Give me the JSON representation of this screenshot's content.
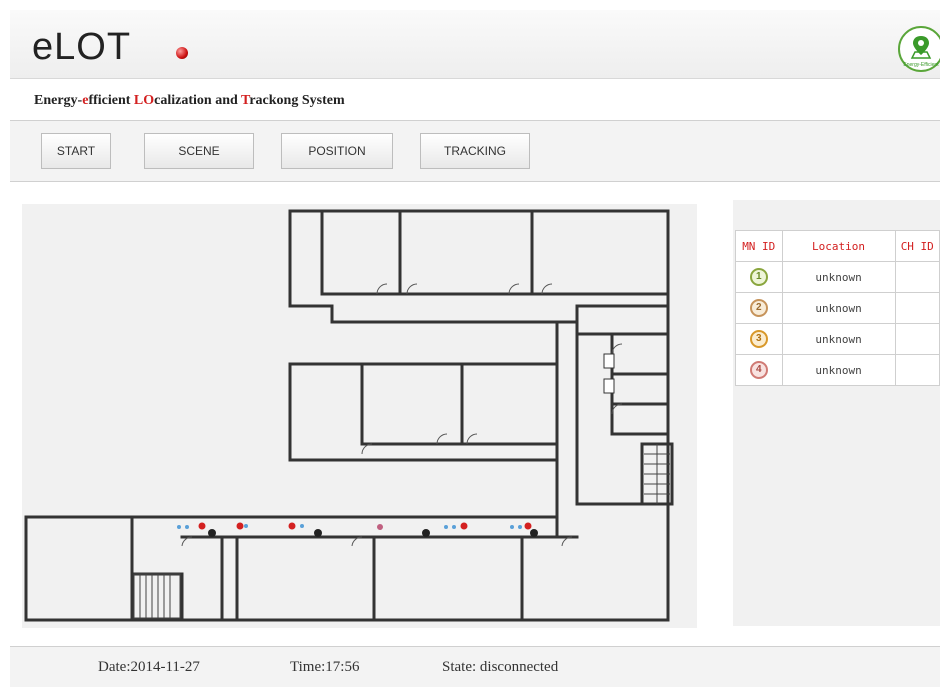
{
  "header": {
    "app_title": "eLOT",
    "logo_text": "Energy-Efficient",
    "subtitle_parts": [
      {
        "text": "Energy-",
        "red": false
      },
      {
        "text": "e",
        "red": true
      },
      {
        "text": "fficient ",
        "red": false
      },
      {
        "text": "LO",
        "red": true
      },
      {
        "text": "calization and ",
        "red": false
      },
      {
        "text": "T",
        "red": true
      },
      {
        "text": "rackong System",
        "red": false
      }
    ]
  },
  "nav": {
    "start": "START",
    "scene": "SCENE",
    "position": "POSITION",
    "tracking": "TRACKING"
  },
  "table": {
    "headers": [
      "MN ID",
      "Location",
      "CH ID"
    ],
    "rows": [
      {
        "id": "1",
        "location": "unknown",
        "ch": ""
      },
      {
        "id": "2",
        "location": "unknown",
        "ch": ""
      },
      {
        "id": "3",
        "location": "unknown",
        "ch": ""
      },
      {
        "id": "4",
        "location": "unknown",
        "ch": ""
      }
    ]
  },
  "footer": {
    "date": "Date:2014-11-27",
    "time": "Time:17:56",
    "state": "State: disconnected"
  },
  "colors": {
    "accent_red": "#d32020",
    "sensor_blue": "#5aa0d8",
    "sensor_black": "#222222",
    "logo_green": "#5aa63a"
  }
}
